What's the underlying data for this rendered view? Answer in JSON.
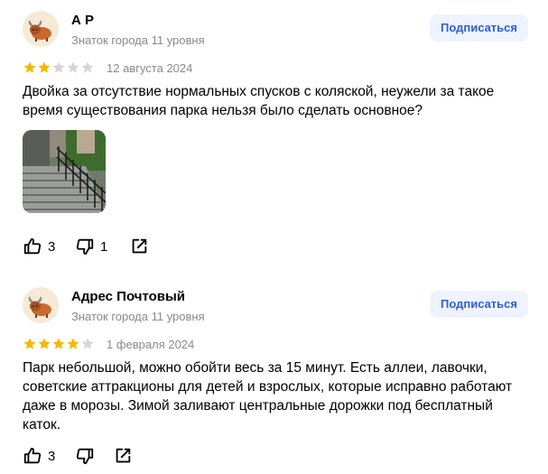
{
  "reviews": [
    {
      "author": "А Р",
      "level": "Знаток города 11 уровня",
      "subscribe_label": "Подписаться",
      "rating": 2,
      "max_rating": 5,
      "date": "12 августа 2024",
      "text": "Двойка за отсутствие нормальных спусков с коляской, неужели за такое время существования парка нельзя было сделать основное?",
      "likes": "3",
      "dislikes": "1",
      "has_photo": true
    },
    {
      "author": "Адрес Почтовый",
      "level": "Знаток города 11 уровня",
      "subscribe_label": "Подписаться",
      "rating": 4,
      "max_rating": 5,
      "date": "1 февраля 2024",
      "text": "Парк небольшой, можно обойти весь за 15 минут. Есть аллеи, лавочки, советские аттракционы для детей и взрослых, которые исправно работают даже в морозы. Зимой заливают центральные дорожки под бесплатный каток.",
      "likes": "3",
      "dislikes": "",
      "has_photo": false
    }
  ],
  "colors": {
    "star_filled": "#f5b800",
    "star_empty": "#d6d6d6",
    "subscribe_bg": "#eef3ff",
    "subscribe_text": "#2f5fd0",
    "muted_text": "#8a8a8a"
  }
}
